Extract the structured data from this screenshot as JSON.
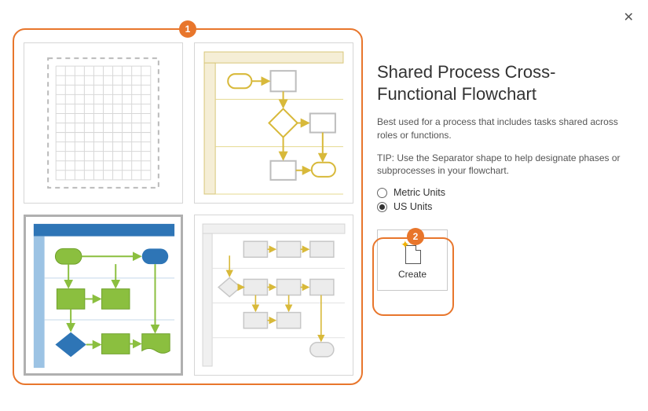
{
  "dialog": {
    "close_label": "✕"
  },
  "template": {
    "title": "Shared Process Cross-Functional Flowchart",
    "description": "Best used for a process that includes tasks shared across roles or functions.",
    "tip": "TIP: Use the Separator shape to help designate phases or subprocesses in your flowchart."
  },
  "units": {
    "options": [
      {
        "label": "Metric Units",
        "checked": false
      },
      {
        "label": "US Units",
        "checked": true
      }
    ]
  },
  "create": {
    "label": "Create"
  },
  "callouts": {
    "one": "1",
    "two": "2"
  },
  "thumbnails": [
    {
      "name": "blank-drawing",
      "selected": false
    },
    {
      "name": "basic-flowchart",
      "selected": false
    },
    {
      "name": "cross-functional-flowchart",
      "selected": true
    },
    {
      "name": "detailed-flowchart",
      "selected": false
    }
  ]
}
